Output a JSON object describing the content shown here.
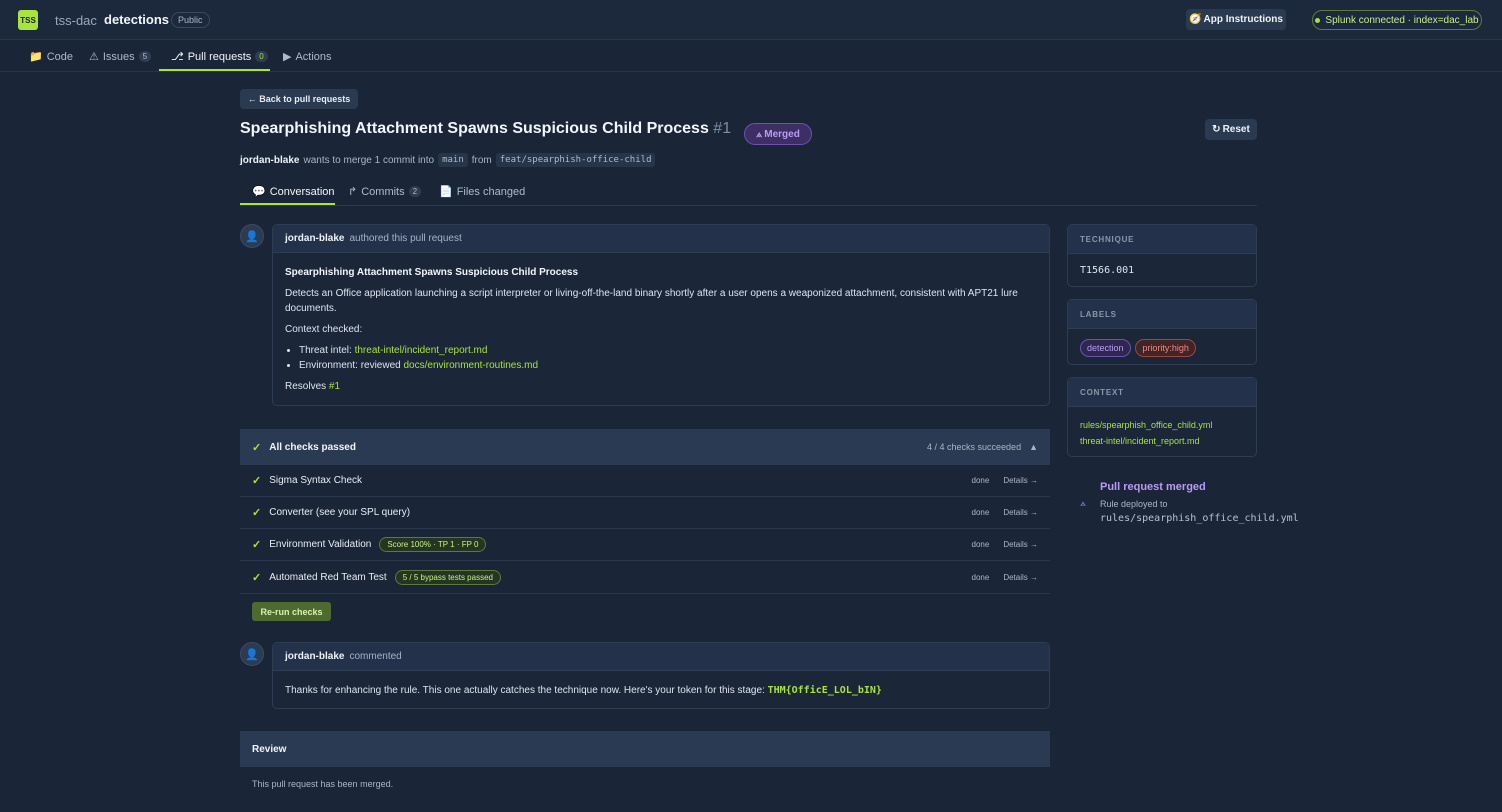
{
  "header": {
    "logo": "TSS",
    "org": "tss-dac",
    "repo": "detections",
    "visibility": "Public",
    "app_instructions": "App Instructions",
    "app_instructions_icon": "compass-icon",
    "splunk_status": "Splunk connected · index=dac_lab"
  },
  "repo_nav": [
    {
      "label": "Code",
      "icon": "folder-icon"
    },
    {
      "label": "Issues",
      "count": "5",
      "icon": "warning-icon"
    },
    {
      "label": "Pull requests",
      "count": "0",
      "icon": "pull-request-icon"
    },
    {
      "label": "Actions",
      "icon": "play-icon"
    }
  ],
  "pr": {
    "back": "← Back to pull requests",
    "title": "Spearphishing Attachment Spawns Suspicious Child Process",
    "number": "#1",
    "status": "Merged",
    "reset": "Reset",
    "author": "jordan-blake",
    "meta_text": "wants to merge 1 commit into",
    "base_branch": "main",
    "from_text": "from",
    "head_branch": "feat/spearphish-office-child",
    "tabs": [
      {
        "label": "Conversation",
        "icon": "chat-icon"
      },
      {
        "label": "Commits",
        "count": "2",
        "icon": "commit-icon"
      },
      {
        "label": "Files changed",
        "icon": "file-icon"
      }
    ]
  },
  "description": {
    "author": "jordan-blake",
    "action": "authored this pull request",
    "heading": "Spearphishing Attachment Spawns Suspicious Child Process",
    "summary": "Detects an Office application launching a script interpreter or living-off-the-land binary shortly after a user opens a weaponized attachment, consistent with APT21 lure documents.",
    "context_label": "Context checked:",
    "items": [
      {
        "prefix": "Threat intel: ",
        "link": "threat-intel/incident_report.md"
      },
      {
        "prefix": "Environment: reviewed ",
        "link": "docs/environment-routines.md"
      }
    ],
    "resolves_label": "Resolves",
    "resolves_link": "#1"
  },
  "checks": {
    "title": "All checks passed",
    "summary": "4 / 4 checks succeeded",
    "rows": [
      {
        "name": "Sigma Syntax Check",
        "badge": "",
        "status": "done",
        "details": "Details →"
      },
      {
        "name": "Converter (see your SPL query)",
        "badge": "",
        "status": "done",
        "details": "Details →"
      },
      {
        "name": "Environment Validation",
        "badge": "Score 100% · TP 1 · FP 0",
        "status": "done",
        "details": "Details →"
      },
      {
        "name": "Automated Red Team Test",
        "badge": "5 / 5 bypass tests passed",
        "status": "done",
        "details": "Details →"
      }
    ],
    "rerun": "Re-run checks"
  },
  "comment": {
    "author": "jordan-blake",
    "action": "commented",
    "text": "Thanks for enhancing the rule. This one actually catches the technique now. Here's your token for this stage:",
    "token": "THM{OfficE_LOL_bIN}"
  },
  "review": {
    "title": "Review",
    "text": "This pull request has been merged."
  },
  "sidebar": {
    "technique_title": "TECHNIQUE",
    "technique": "T1566.001",
    "labels_title": "LABELS",
    "labels": [
      "detection",
      "priority:high"
    ],
    "context_title": "CONTEXT",
    "context_links": [
      "rules/spearphish_office_child.yml",
      "threat-intel/incident_report.md"
    ],
    "merged_title": "Pull request merged",
    "merged_sub": "Rule deployed to",
    "merged_path": "rules/spearphish_office_child.yml"
  },
  "colors": {
    "accent": "#a8e33f",
    "merged": "#b89cf4",
    "background": "#1a2638"
  }
}
